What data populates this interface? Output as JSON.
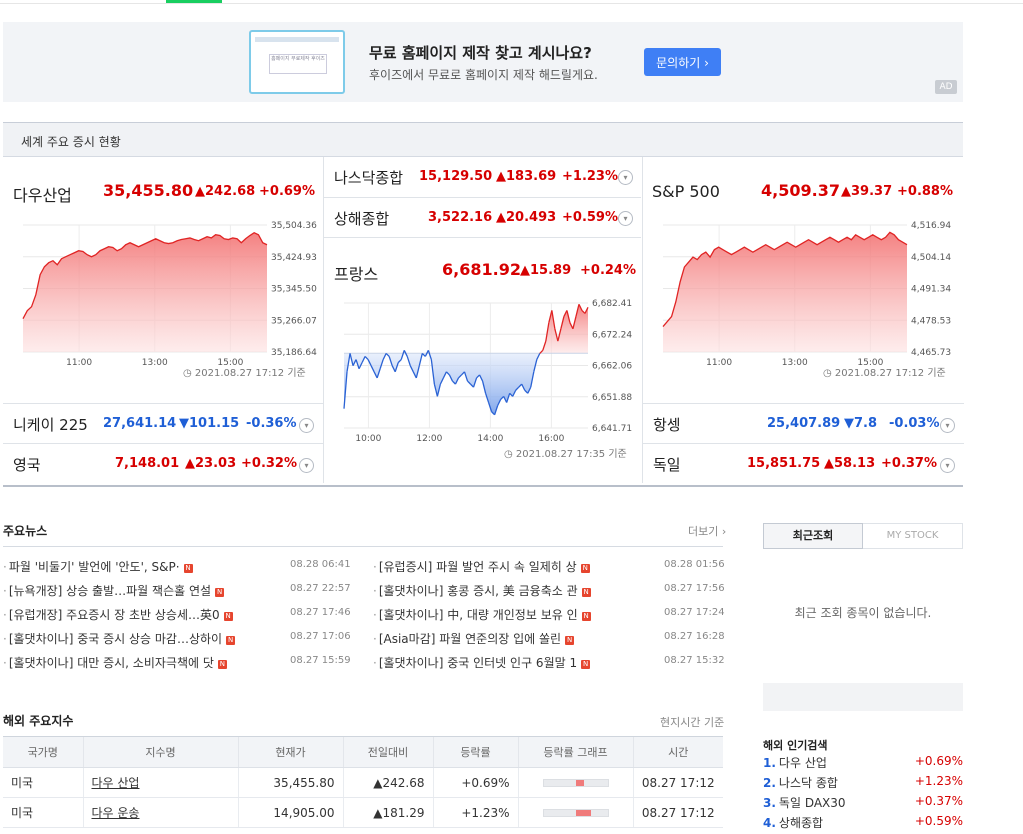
{
  "ad": {
    "title": "무료 홈페이지 제작 찾고 계시나요?",
    "subtitle": "후이즈에서 무료로 홈페이지 제작 해드릴게요.",
    "button": "문의하기 ›",
    "tag": "AD",
    "thumb_text": "홈페이지 무료제작 후이즈"
  },
  "markets": {
    "header": "세계 주요 증시 현황",
    "dow": {
      "name": "다우산업",
      "value": "35,455.80",
      "change": "▲242.68",
      "rate": "+0.69%",
      "yticks": [
        "35,504.36",
        "35,424.93",
        "35,345.50",
        "35,266.07",
        "35,186.64"
      ],
      "xticks": [
        "11:00",
        "13:00",
        "15:00"
      ],
      "stamp": "2021.08.27 17:12 기준",
      "series": [
        35270,
        35290,
        35300,
        35330,
        35380,
        35400,
        35410,
        35415,
        35405,
        35420,
        35425,
        35430,
        35435,
        35440,
        35438,
        35430,
        35425,
        35430,
        35440,
        35445,
        35450,
        35448,
        35440,
        35445,
        35455,
        35460,
        35455,
        35450,
        35455,
        35460,
        35465,
        35470,
        35465,
        35460,
        35458,
        35460,
        35465,
        35468,
        35470,
        35472,
        35468,
        35465,
        35470,
        35475,
        35472,
        35480,
        35478,
        35470,
        35468,
        35472,
        35470,
        35460,
        35470,
        35478,
        35485,
        35480,
        35460,
        35455
      ],
      "ylim": [
        35186.64,
        35504.36
      ]
    },
    "nasdaq": {
      "name": "나스닥종합",
      "value": "15,129.50",
      "change": "▲183.69",
      "rate": "+1.23%"
    },
    "shanghai": {
      "name": "상해종합",
      "value": "3,522.16",
      "change": "▲20.493",
      "rate": "+0.59%"
    },
    "france": {
      "name": "프랑스",
      "value": "6,681.92",
      "change": "▲15.89",
      "rate": "+0.24%",
      "yticks": [
        "6,682.41",
        "6,672.24",
        "6,662.06",
        "6,651.88",
        "6,641.71"
      ],
      "xticks": [
        "10:00",
        "12:00",
        "14:00",
        "16:00"
      ],
      "stamp": "2021.08.27 17:35 기준",
      "baseline": 6666.03,
      "series": [
        6648,
        6660,
        6666,
        6662,
        6664,
        6661,
        6663,
        6665,
        6664,
        6662,
        6660,
        6658,
        6661,
        6664,
        6666,
        6665,
        6662,
        6660,
        6663,
        6664,
        6667,
        6665,
        6662,
        6660,
        6658,
        6662,
        6666,
        6665,
        6667,
        6664,
        6656,
        6652,
        6656,
        6658,
        6660,
        6659,
        6657,
        6656,
        6658,
        6659,
        6660,
        6657,
        6656,
        6655,
        6658,
        6659,
        6657,
        6653,
        6650,
        6647,
        6646,
        6649,
        6651,
        6652,
        6650,
        6653,
        6652,
        6654,
        6655,
        6656,
        6654,
        6653,
        6655,
        6660,
        6664,
        6666,
        6667,
        6670,
        6676,
        6680,
        6674,
        6670,
        6674,
        6678,
        6680,
        6676,
        6674,
        6678,
        6682,
        6680,
        6679,
        6681
      ],
      "ylim": [
        6641.71,
        6682.41
      ]
    },
    "sp500": {
      "name": "S&P 500",
      "value": "4,509.37",
      "change": "▲39.37",
      "rate": "+0.88%",
      "yticks": [
        "4,516.94",
        "4,504.14",
        "4,491.34",
        "4,478.53",
        "4,465.73"
      ],
      "xticks": [
        "11:00",
        "13:00",
        "15:00"
      ],
      "stamp": "2021.08.27 17:12 기준",
      "series": [
        4476,
        4478,
        4480,
        4486,
        4494,
        4500,
        4502,
        4504,
        4503,
        4505,
        4506,
        4504,
        4507,
        4508,
        4507,
        4506,
        4505,
        4506,
        4507,
        4508,
        4507,
        4506,
        4507,
        4508,
        4509,
        4508,
        4507,
        4508,
        4509,
        4510,
        4509,
        4508,
        4509,
        4510,
        4511,
        4510,
        4509,
        4510,
        4511,
        4512,
        4511,
        4510,
        4511,
        4512,
        4511,
        4513,
        4512,
        4511,
        4512,
        4513,
        4512,
        4511,
        4512,
        4514,
        4513,
        4511,
        4510,
        4509
      ],
      "ylim": [
        4465.73,
        4516.94
      ]
    },
    "nikkei": {
      "name": "니케이 225",
      "value": "27,641.14",
      "change": "▼101.15",
      "rate": "-0.36%"
    },
    "uk": {
      "name": "영국",
      "value": "7,148.01",
      "change": "▲23.03",
      "rate": "+0.32%"
    },
    "hangseng": {
      "name": "항셍",
      "value": "25,407.89",
      "change": "▼7.8",
      "rate": "-0.03%"
    },
    "germany": {
      "name": "독일",
      "value": "15,851.75",
      "change": "▲58.13",
      "rate": "+0.37%"
    }
  },
  "news": {
    "title": "주요뉴스",
    "more": "더보기 ›",
    "left": [
      {
        "text": "파월 '비둘기' 발언에 '안도', S&P·",
        "time": "08.28 06:41"
      },
      {
        "text": "[뉴욕개장] 상승 출발…파월 잭슨홀 연설",
        "time": "08.27 22:57"
      },
      {
        "text": "[유럽개장] 주요증시 장 초반 상승세…英0",
        "time": "08.27 17:46"
      },
      {
        "text": "[홀댓차이나] 중국 증시 상승 마감…상하이",
        "time": "08.27 17:06"
      },
      {
        "text": "[홀댓차이나] 대만 증시, 소비자극책에 닷",
        "time": "08.27 15:59"
      }
    ],
    "right": [
      {
        "text": "[유럽증시] 파월 발언 주시 속 일제히 상",
        "time": "08.28 01:56"
      },
      {
        "text": "[홀댓차이나] 홍콩 증시, 美 금융축소 관",
        "time": "08.27 17:56"
      },
      {
        "text": "[홀댓차이나] 中, 대량 개인정보 보유 인",
        "time": "08.27 17:24"
      },
      {
        "text": "[Asia마감] 파월 연준의장 입에 쏠린",
        "time": "08.27 16:28"
      },
      {
        "text": "[홀댓차이나] 중국 인터넷 인구 6월말 1",
        "time": "08.27 15:32"
      }
    ],
    "badge": "N"
  },
  "recent": {
    "tab_recent": "최근조회",
    "tab_mystock": "MY STOCK",
    "empty": "최근 조회 종목이 없습니다."
  },
  "popular": {
    "title": "해외 인기검색",
    "items": [
      {
        "rank": "1.",
        "name": "다우 산업",
        "rate": "+0.69%"
      },
      {
        "rank": "2.",
        "name": "나스닥 종합",
        "rate": "+1.23%"
      },
      {
        "rank": "3.",
        "name": "독일 DAX30",
        "rate": "+0.37%"
      },
      {
        "rank": "4.",
        "name": "상해종합",
        "rate": "+0.59%"
      }
    ]
  },
  "indices": {
    "title": "해외 주요지수",
    "note": "현지시간 기준",
    "headers": [
      "국가명",
      "지수명",
      "현재가",
      "전일대비",
      "등락률",
      "등락률 그래프",
      "시간"
    ],
    "rows": [
      {
        "country": "미국",
        "name": "다우 산업",
        "price": "35,455.80",
        "change": "▲242.68",
        "rate": "+0.69%",
        "bar": 0.69,
        "time": "08.27 17:12"
      },
      {
        "country": "미국",
        "name": "다우 운송",
        "price": "14,905.00",
        "change": "▲181.29",
        "rate": "+1.23%",
        "bar": 1.23,
        "time": "08.27 17:12"
      }
    ]
  },
  "colors": {
    "up": "#d60000",
    "down": "#1f5fd6",
    "accent": "#3f7ff5",
    "brand": "#19ce60"
  }
}
